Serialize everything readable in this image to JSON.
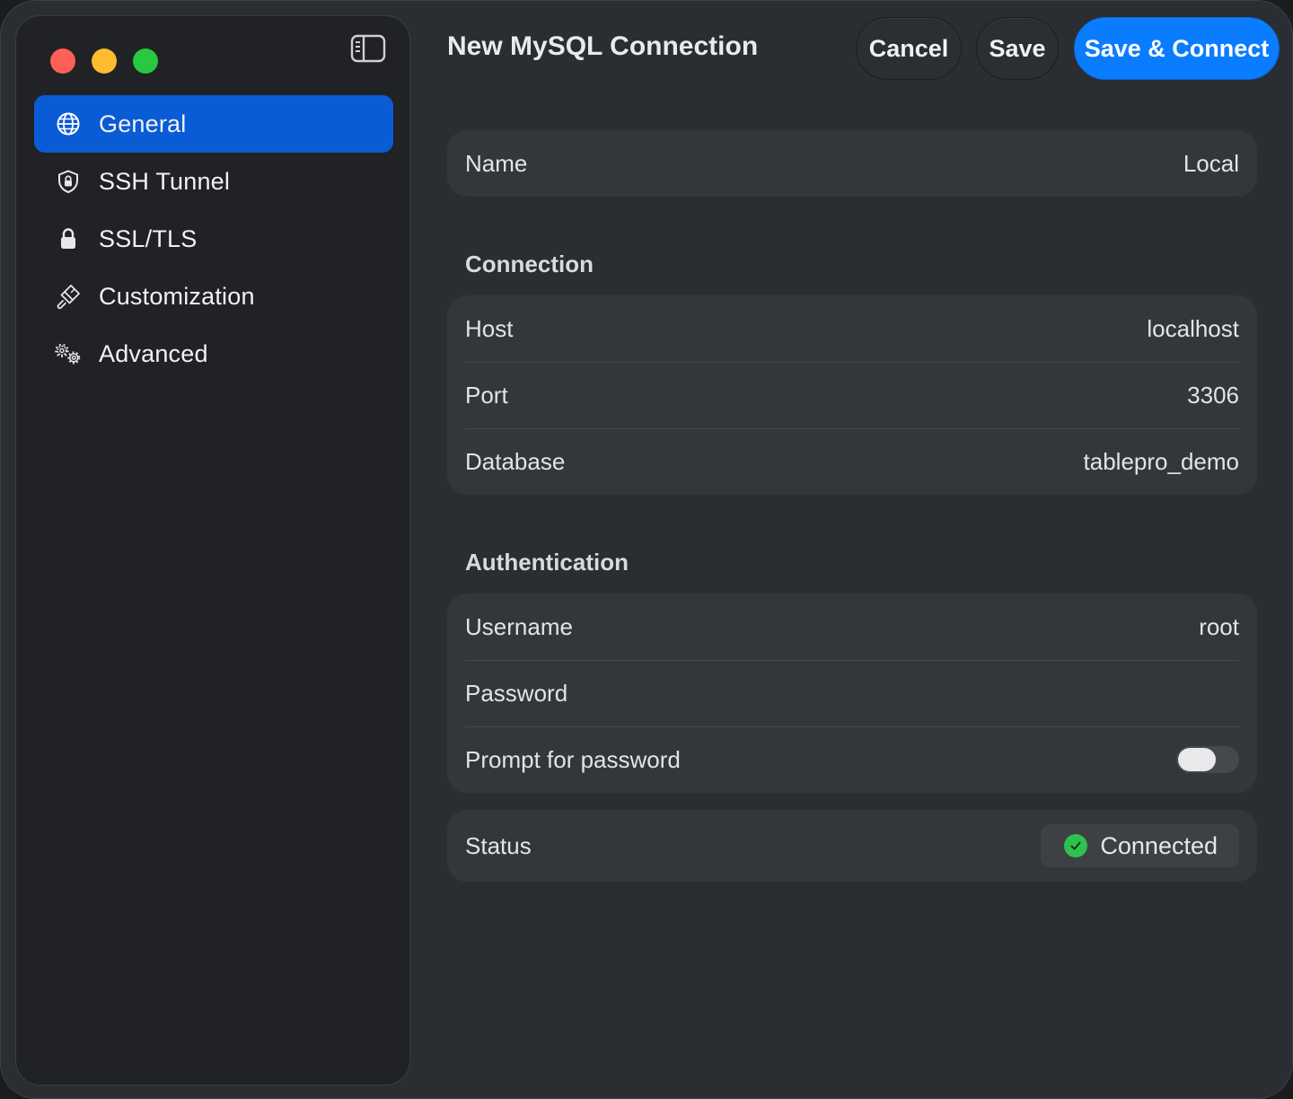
{
  "window": {
    "title": "New MySQL Connection"
  },
  "toolbar": {
    "cancel_label": "Cancel",
    "save_label": "Save",
    "save_connect_label": "Save & Connect"
  },
  "sidebar": {
    "items": [
      {
        "label": "General",
        "icon": "globe-icon",
        "active": true
      },
      {
        "label": "SSH Tunnel",
        "icon": "shield-lock-icon",
        "active": false
      },
      {
        "label": "SSL/TLS",
        "icon": "lock-icon",
        "active": false
      },
      {
        "label": "Customization",
        "icon": "paintbrush-icon",
        "active": false
      },
      {
        "label": "Advanced",
        "icon": "gears-icon",
        "active": false
      }
    ]
  },
  "general": {
    "name_label": "Name",
    "name_value": "Local"
  },
  "connection": {
    "section_title": "Connection",
    "host_label": "Host",
    "host_value": "localhost",
    "port_label": "Port",
    "port_value": "3306",
    "database_label": "Database",
    "database_value": "tablepro_demo"
  },
  "authentication": {
    "section_title": "Authentication",
    "username_label": "Username",
    "username_value": "root",
    "password_label": "Password",
    "password_value": "",
    "prompt_label": "Prompt for password",
    "prompt_enabled": false
  },
  "status": {
    "label": "Status",
    "value": "Connected",
    "color": "#2ec14f"
  },
  "colors": {
    "accent": "#0a7cff",
    "sidebar_active": "#0a5bd6"
  }
}
